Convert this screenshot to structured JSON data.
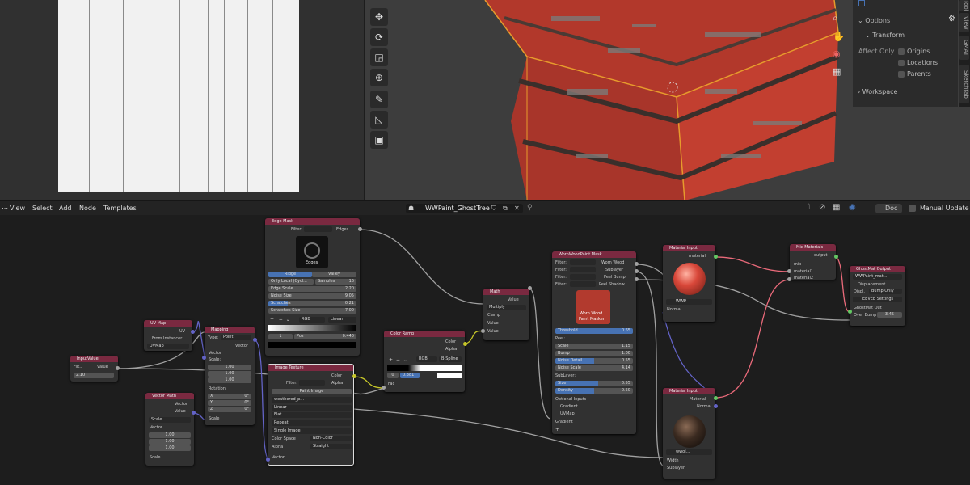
{
  "menu": {
    "view": "View",
    "select": "Select",
    "add": "Add",
    "node": "Node",
    "templates": "Templates"
  },
  "tree": {
    "name": "WWPaint_GhostTree",
    "pin": "pin-icon"
  },
  "header_right": {
    "doc": "Doc",
    "manual_update": "Manual Update"
  },
  "npanel": {
    "options": "Options",
    "transform": "Transform",
    "affect_only": "Affect Only",
    "origins": "Origins",
    "locations": "Locations",
    "parents": "Parents",
    "workspace": "Workspace"
  },
  "vtabs": [
    "Tool",
    "View",
    "GMAT",
    "Sketchfab"
  ],
  "nodes": {
    "inputvalue": {
      "title": "InputValue",
      "filter": "Filt..",
      "value_label": "Value",
      "value": "2.10"
    },
    "uvmap": {
      "title": "UV Map",
      "uv": "UV",
      "from_instancer": "From Instancer",
      "map": "UVMap"
    },
    "vecmath": {
      "title": "Vector Math",
      "vector": "Vector",
      "value": "Value",
      "op": "Scale",
      "vec_label": "Vector",
      "x": "1.00",
      "y": "1.00",
      "z": "1.00",
      "scale": "Scale"
    },
    "mapping": {
      "title": "Mapping",
      "type_label": "Type:",
      "type": "Point",
      "vector": "Vector",
      "vin": "Vector",
      "scale_label": "Scale:",
      "sx": "1.00",
      "sy": "1.00",
      "sz": "1.00",
      "rot_label": "Rotation:",
      "rx": "X",
      "ry": "Y",
      "rz": "Z",
      "rxv": "0°",
      "ryv": "0°",
      "rzv": "0°",
      "scale": "Scale"
    },
    "edgemask": {
      "title": "Edge Mask",
      "filter": "Filter:",
      "edges": "Edges",
      "thumb": "Edges",
      "tab1": "Ridge",
      "tab2": "Valley",
      "only_local": "Only Local (Cycl...",
      "samples_label": "Samples",
      "samples": "16",
      "edge_scale_l": "Edge Scale",
      "edge_scale": "2.20",
      "noise_size_l": "Noise Size",
      "noise_size": "9.05",
      "scratches_l": "Scratches",
      "scratches": "0.21",
      "scratches_size_l": "Scratches Size",
      "scratches_size": "7.00",
      "rgb": "RGB",
      "linear": "Linear",
      "pos": "Pos",
      "pos_v": "0.440"
    },
    "imgtex": {
      "title": "Image Texture",
      "filter": "Filter:",
      "color": "Color",
      "alpha": "Alpha",
      "paint": "Paint Image",
      "img": "weathered_p...",
      "linear": "Linear",
      "flat": "Flat",
      "repeat": "Repeat",
      "single": "Single Image",
      "cs_label": "Color Space",
      "cs": "Non-Color",
      "alpha_label": "Alpha",
      "alpha_v": "Straight",
      "vector": "Vector"
    },
    "colorramp": {
      "title": "Color Ramp",
      "color": "Color",
      "alpha": "Alpha",
      "rgb": "RGB",
      "interp": "B-Spline",
      "idx": "0",
      "pos": "0.381",
      "fac": "Fac"
    },
    "math": {
      "title": "Math",
      "value": "Value",
      "op": "Multiply",
      "clamp": "Clamp",
      "v1": "Value",
      "v2": "Value"
    },
    "wwpaint": {
      "title": "WornWoodPaint Mask",
      "f1": "Filter:",
      "o1": "Worn Wood",
      "f2": "Filter:",
      "o2": "Sublayer",
      "f3": "Filter:",
      "o3": "Peel Bump",
      "f4": "Filter:",
      "o4": "Peel Shadow",
      "thumb1": "Worn Wood",
      "thumb2": "Paint Masker",
      "thr_l": "Threshold",
      "thr": "0.65",
      "peel": "Peel:",
      "scale_l": "Scale",
      "scale": "1.15",
      "bump_l": "Bump",
      "bump": "1.00",
      "nd_l": "Noise Detail",
      "nd": "0.55",
      "ns_l": "Noise Scale",
      "ns": "4.14",
      "sub": "SubLayer:",
      "size_l": "Size",
      "size": "0.55",
      "den_l": "Density",
      "den": "0.50",
      "opt": "Optional Inputs",
      "grad": "Gradient",
      "uvmap": "UVMap",
      "grad2": "Gradient"
    },
    "matinput1": {
      "title": "Material Input",
      "material": "material",
      "name": "WWP...",
      "normal": "Normal"
    },
    "matinput2": {
      "title": "Material Input",
      "material": "Material",
      "normal": "Normal",
      "name": "wwol...",
      "width": "Width",
      "sublayer": "Sublayer"
    },
    "mix": {
      "title": "Mix Materials",
      "output": "output",
      "mix": "mix",
      "m1": "material1",
      "m2": "material2"
    },
    "ghostout": {
      "title": "GhostMat Output",
      "name": "WWPaint_mat...",
      "disp": "Displacement",
      "displ_l": "Displ.",
      "displ": "Bump Only",
      "eevee": "EEVEE Settings",
      "ghost": "GhostMat Out",
      "ob_l": "Over Bump",
      "ob": "3.45"
    }
  }
}
